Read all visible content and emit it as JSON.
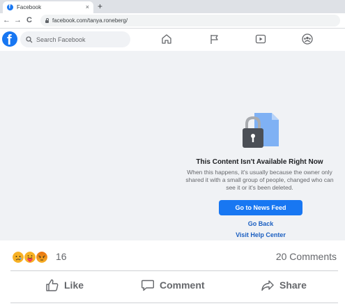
{
  "browser": {
    "tab_title": "Facebook",
    "tab_close": "×",
    "new_tab": "+",
    "back": "←",
    "forward": "→",
    "reload": "C",
    "url": "facebook.com/tanya.roneberg/"
  },
  "header": {
    "logo": "f",
    "search_placeholder": "Search Facebook",
    "nav_icons": [
      "home-icon",
      "flag-icon",
      "watch-icon",
      "groups-icon"
    ]
  },
  "unavailable": {
    "title": "This Content Isn't Available Right Now",
    "description_lines": [
      "When this happens, it's usually because the owner only",
      "shared it with a small group of people, changed who can",
      "see it or it's been deleted."
    ],
    "primary_button": "Go to News Feed",
    "link_back": "Go Back",
    "link_help": "Visit Help Center"
  },
  "post_footer": {
    "reactions": [
      "sad",
      "care",
      "angry"
    ],
    "reaction_count": "16",
    "comments": "20 Comments",
    "actions": {
      "like": "Like",
      "comment": "Comment",
      "share": "Share"
    }
  },
  "colors": {
    "brand": "#1877f2",
    "background": "#f0f2f5",
    "secondary_text": "#65676b",
    "link": "#1b5fc1"
  }
}
